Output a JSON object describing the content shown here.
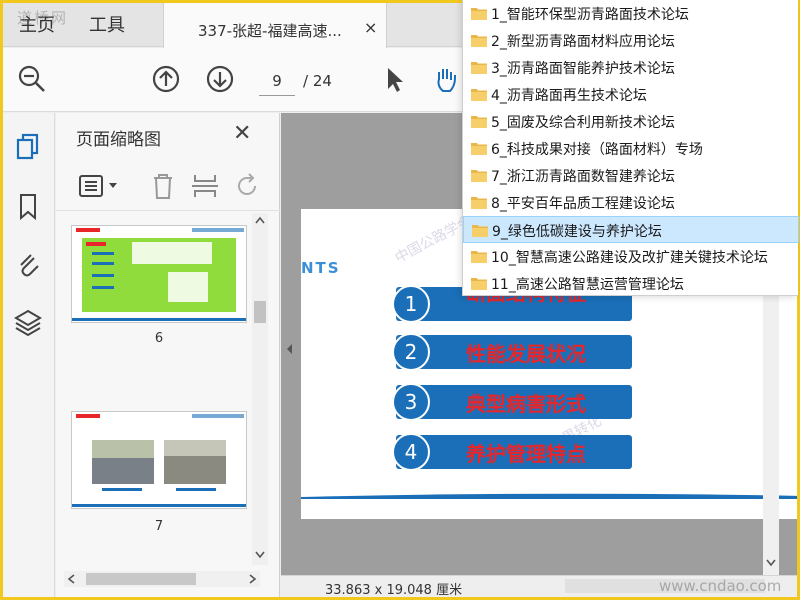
{
  "tabs": {
    "home": "主页",
    "tools": "工具",
    "document_title": "337-张超-福建高速...",
    "close": "×"
  },
  "toolbar": {
    "current_page": "9",
    "page_total": "/ 24"
  },
  "thumb_panel": {
    "title": "页面缩略图",
    "close": "✕",
    "thumbs": [
      {
        "label": "6"
      },
      {
        "label": "7"
      }
    ]
  },
  "slide": {
    "contents_word": "NTS",
    "items": [
      {
        "num": "1",
        "text": "断面结构特征"
      },
      {
        "num": "2",
        "text": "性能发展状况"
      },
      {
        "num": "3",
        "text": "典型病害形式"
      },
      {
        "num": "4",
        "text": "养护管理特点"
      }
    ]
  },
  "status": {
    "dimensions": "33.863 x 19.048 厘米"
  },
  "watermarks": {
    "top_left": "道桥网",
    "site": "www.cndao.com"
  },
  "dropdown": {
    "items": [
      {
        "label": "1_智能环保型沥青路面技术论坛"
      },
      {
        "label": "2_新型沥青路面材料应用论坛"
      },
      {
        "label": "3_沥青路面智能养护技术论坛"
      },
      {
        "label": "4_沥青路面再生技术论坛"
      },
      {
        "label": "5_固废及综合利用新技术论坛"
      },
      {
        "label": "6_科技成果对接（路面材料）专场"
      },
      {
        "label": "7_浙江沥青路面数智建养论坛"
      },
      {
        "label": "8_平安百年品质工程建设论坛"
      },
      {
        "label": "9_绿色低碳建设与养护论坛"
      },
      {
        "label": "10_智慧高速公路建设及改扩建关键技术论坛"
      },
      {
        "label": "11_高速公路智慧运营管理论坛"
      }
    ],
    "selected_index": 8
  },
  "colors": {
    "frame_border": "#f0c81e",
    "pill_blue": "#1a6fb8",
    "pill_text_red": "#e8262a",
    "selected_row": "#cce8ff",
    "folder": "#e8b84a"
  }
}
